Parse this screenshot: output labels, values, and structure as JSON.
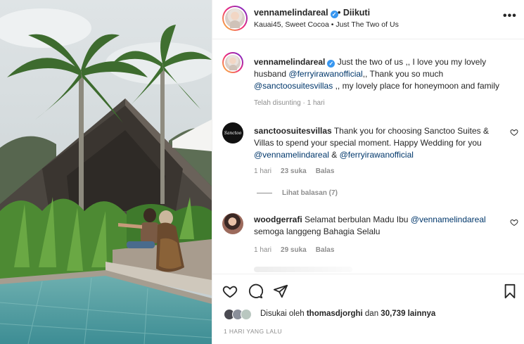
{
  "header": {
    "username": "vennamelindareal",
    "follow_separator": "•",
    "follow_status": "Diikuti",
    "location": "Kauai45, Sweet Cocoa • Just The Two of Us",
    "more_icon": "more-horizontal-icon"
  },
  "caption": {
    "username": "vennamelindareal",
    "text_1": " Just the two of us ,, I love you my lovely husband ",
    "mention_1": "@ferryirawanofficial",
    "text_2": ",, Thank you so much ",
    "mention_2": "@sanctoosuitesvillas",
    "text_3": " ,, my lovely place for honeymoon and family",
    "meta": "Telah disunting · 1 hari"
  },
  "comments": [
    {
      "avatar_text": "Sanctoo",
      "username": "sanctoosuitesvillas",
      "text_1": " Thank you for choosing Sanctoo Suites & Villas to spend your special moment. Happy Wedding for you ",
      "mention_1": "@vennamelindareal",
      "text_2": " & ",
      "mention_2": "@ferryirawanofficial",
      "time": "1 hari",
      "likes": "23 suka",
      "reply": "Balas",
      "view_replies": "Lihat balasan (7)"
    },
    {
      "username": "woodgerrafi",
      "text_1": " Selamat berbulan Madu Ibu ",
      "mention_1": "@vennamelindareal",
      "text_2": " semoga langgeng Bahagia Selalu",
      "time": "1 hari",
      "likes": "29 suka",
      "reply": "Balas"
    }
  ],
  "liked_by": {
    "prefix": "Disukai oleh ",
    "user": "thomasdjorghi",
    "middle": " dan ",
    "count": "30,739 lainnya"
  },
  "post_date": "1 HARI YANG LALU",
  "colors": {
    "text": "#262626",
    "muted": "#8e8e8e",
    "mention": "#00376b",
    "verified": "#3897f0",
    "divider": "#efefef"
  }
}
